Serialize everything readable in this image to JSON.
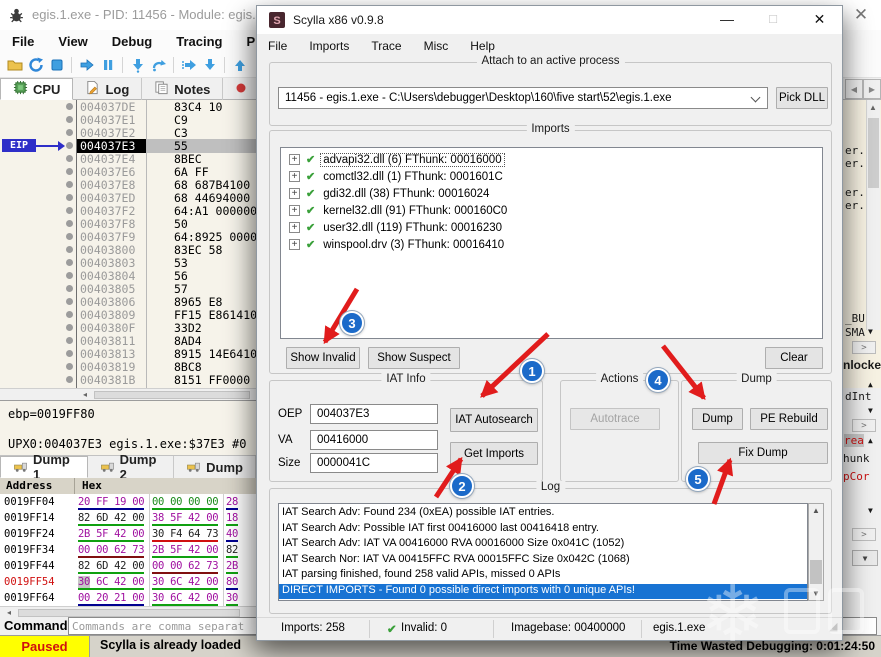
{
  "debugger": {
    "title": "egis.1.exe - PID: 11456 - Module: egis.",
    "menu": [
      "File",
      "View",
      "Debug",
      "Tracing",
      "Plugins"
    ],
    "toolbar_icons": [
      "open-folder-icon",
      "restart-icon",
      "stop-icon",
      "sep",
      "run-icon",
      "pause-icon",
      "sep",
      "step-into-icon",
      "step-over-icon",
      "sep",
      "execute-till-return-icon",
      "step-out-icon",
      "sep",
      "run-to-user-icon"
    ],
    "tabs": [
      {
        "label": "CPU",
        "icon": "cpu-icon"
      },
      {
        "label": "Log",
        "icon": "log-icon"
      },
      {
        "label": "Notes",
        "icon": "notes-icon"
      },
      {
        "label": "",
        "icon": "breakpoint-dot-icon"
      }
    ],
    "disasm": {
      "eip_label": "EIP",
      "eip_index": 3,
      "rows": [
        {
          "a": "004037DE",
          "b": "83C4 10"
        },
        {
          "a": "004037E1",
          "b": "C9"
        },
        {
          "a": "004037E2",
          "b": "C3"
        },
        {
          "a": "004037E3",
          "b": "55"
        },
        {
          "a": "004037E4",
          "b": "8BEC"
        },
        {
          "a": "004037E6",
          "b": "6A FF"
        },
        {
          "a": "004037E8",
          "b": "68 687B4100"
        },
        {
          "a": "004037ED",
          "b": "68 44694000"
        },
        {
          "a": "004037F2",
          "b": "64:A1 000000"
        },
        {
          "a": "004037F8",
          "b": "50"
        },
        {
          "a": "004037F9",
          "b": "64:8925 0000"
        },
        {
          "a": "00403800",
          "b": "83EC 58"
        },
        {
          "a": "00403803",
          "b": "53"
        },
        {
          "a": "00403804",
          "b": "56"
        },
        {
          "a": "00403805",
          "b": "57"
        },
        {
          "a": "00403806",
          "b": "8965 E8"
        },
        {
          "a": "00403809",
          "b": "FF15 E861410"
        },
        {
          "a": "0040380F",
          "b": "33D2"
        },
        {
          "a": "00403811",
          "b": "8AD4"
        },
        {
          "a": "00403813",
          "b": "8915 14E6410"
        },
        {
          "a": "00403819",
          "b": "8BC8"
        },
        {
          "a": "0040381B",
          "b": "8151 FF0000"
        }
      ]
    },
    "info_pane": {
      "line1": "ebp=0019FF80",
      "line2": "UPX0:004037E3 egis.1.exe:$37E3 #0"
    },
    "dump_tabs": [
      {
        "label": "Dump 1"
      },
      {
        "label": "Dump 2"
      },
      {
        "label": "Dump"
      }
    ],
    "hex_view": {
      "headers": [
        "Address",
        "Hex"
      ],
      "rows": [
        {
          "addr": "0019FF04",
          "red": false,
          "g": [
            {
              "t": "20 FF 19 00",
              "c": "#a010a0",
              "u": "#000090"
            },
            {
              "t": "00 00 00 00",
              "c": "#1a8a1a",
              "u": "#10a010"
            },
            {
              "t": "28",
              "c": "#a010a0",
              "u": "#000090"
            }
          ]
        },
        {
          "addr": "0019FF14",
          "red": false,
          "g": [
            {
              "t": "82 6D 42 00",
              "c": "#222222",
              "u": "#10a010"
            },
            {
              "t": "38 5F 42 00",
              "c": "#a010a0",
              "u": "#10a010"
            },
            {
              "t": "18",
              "c": "#a010a0",
              "u": "#10a010"
            }
          ]
        },
        {
          "addr": "0019FF24",
          "red": false,
          "g": [
            {
              "t": "2B 5F 42 00",
              "c": "#a010a0",
              "u": "#10a010"
            },
            {
              "t": "30 F4 64 73",
              "c": "#222222",
              "u": "#d01010"
            },
            {
              "t": "40",
              "c": "#a010a0",
              "u": "#000090"
            }
          ]
        },
        {
          "addr": "0019FF34",
          "red": false,
          "g": [
            {
              "t": "00 00 62 73",
              "c": "#a010a0",
              "u": "#801010"
            },
            {
              "t": "2B 5F 42 00",
              "c": "#a010a0",
              "u": "#10a010"
            },
            {
              "t": "82",
              "c": "#222222",
              "u": "#10a010"
            }
          ]
        },
        {
          "addr": "0019FF44",
          "red": false,
          "g": [
            {
              "t": "82 6D 42 00",
              "c": "#222222",
              "u": "#10a010"
            },
            {
              "t": "00 00 62 73",
              "c": "#a010a0",
              "u": "#801010"
            },
            {
              "t": "2B",
              "c": "#a010a0",
              "u": "#10a010"
            }
          ]
        },
        {
          "addr": "0019FF54",
          "red": true,
          "g": [
            {
              "t": "30 6C 42 00",
              "c": "#a010a0",
              "u": "#10a010",
              "sel": true
            },
            {
              "t": "30 6C 42 00",
              "c": "#a010a0",
              "u": "#10a010"
            },
            {
              "t": "80",
              "c": "#a010a0",
              "u": "#000090"
            }
          ]
        },
        {
          "addr": "0019FF64",
          "red": false,
          "g": [
            {
              "t": "00 20 21 00",
              "c": "#a010a0",
              "u": "#000090"
            },
            {
              "t": "30 6C 42 00",
              "c": "#a010a0",
              "u": "#10a010"
            },
            {
              "t": "30",
              "c": "#a010a0",
              "u": "#10a010"
            }
          ]
        }
      ]
    },
    "command": {
      "label": "Command:",
      "placeholder": "Commands are comma separat"
    },
    "status": {
      "state": "Paused",
      "message": "Scylla is already loaded",
      "time": "Time Wasted Debugging: 0:01:24:50"
    },
    "right_sliver": {
      "close_glyph": "✕",
      "tab_scroll_left": "◀",
      "tab_scroll_right": "▶",
      "scroll_up": "▲",
      "scroll_down": "▼",
      "chevron": ">",
      "dropdown": "▼",
      "register_fragments": [
        "er.",
        "er.",
        "er.",
        "er."
      ],
      "mid_fragments": [
        "_BU",
        "SMA",
        "nlocke"
      ],
      "pane2_fragment": "dInt",
      "pane3_fragments": [
        "rea",
        "hunk",
        "pCor"
      ]
    }
  },
  "scylla": {
    "title": "Scylla x86 v0.9.8",
    "window_buttons": {
      "minimize": "—",
      "maximize": "□",
      "close": "✕"
    },
    "menu": [
      "File",
      "Imports",
      "Trace",
      "Misc",
      "Help"
    ],
    "attach": {
      "group_label": "Attach to an active process",
      "process": "11456 - egis.1.exe - C:\\Users\\debugger\\Desktop\\160\\five start\\52\\egis.1.exe",
      "pick_dll_label": "Pick DLL"
    },
    "imports": {
      "group_label": "Imports",
      "items": [
        "advapi32.dll (6) FThunk: 00016000",
        "comctl32.dll (1) FThunk: 0001601C",
        "gdi32.dll (38) FThunk: 00016024",
        "kernel32.dll (91) FThunk: 000160C0",
        "user32.dll (119) FThunk: 00016230",
        "winspool.drv (3) FThunk: 00016410"
      ],
      "show_invalid_label": "Show Invalid",
      "show_suspect_label": "Show Suspect",
      "clear_label": "Clear"
    },
    "iat_info": {
      "group_label": "IAT Info",
      "oep_label": "OEP",
      "oep_value": "004037E3",
      "va_label": "VA",
      "va_value": "00416000",
      "size_label": "Size",
      "size_value": "0000041C",
      "autosearch_label": "IAT Autosearch",
      "get_imports_label": "Get Imports"
    },
    "actions": {
      "group_label": "Actions",
      "autotrace_label": "Autotrace"
    },
    "dump": {
      "group_label": "Dump",
      "dump_label": "Dump",
      "pe_rebuild_label": "PE Rebuild",
      "fix_dump_label": "Fix Dump"
    },
    "log": {
      "group_label": "Log",
      "selected_index": 5,
      "lines": [
        "IAT Search Adv: Found 234 (0xEA) possible IAT entries.",
        "IAT Search Adv: Possible IAT first 00416000 last 00416418 entry.",
        "IAT Search Adv: IAT VA 00416000 RVA 00016000 Size 0x041C (1052)",
        "IAT Search Nor: IAT VA 00415FFC RVA 00015FFC Size 0x042C (1068)",
        "IAT parsing finished, found 258 valid APIs, missed 0 APIs",
        "DIRECT IMPORTS - Found 0 possible direct imports with 0 unique APIs!"
      ]
    },
    "statusbar": {
      "imports": "Imports: 258",
      "invalid": "Invalid: 0",
      "imagebase": "Imagebase: 00400000",
      "module": "egis.1.exe"
    }
  },
  "annotations": {
    "steps": [
      "1",
      "2",
      "3",
      "4",
      "5"
    ]
  },
  "colors": {
    "accent_blue": "#1b6ac9",
    "arrow_red": "#e11c1c",
    "selection_blue": "#1873d3",
    "paused_bg": "#ffff00",
    "paused_fg": "#d01010",
    "check_green": "#3aa03a",
    "eip_blue": "#2e2ec8"
  }
}
